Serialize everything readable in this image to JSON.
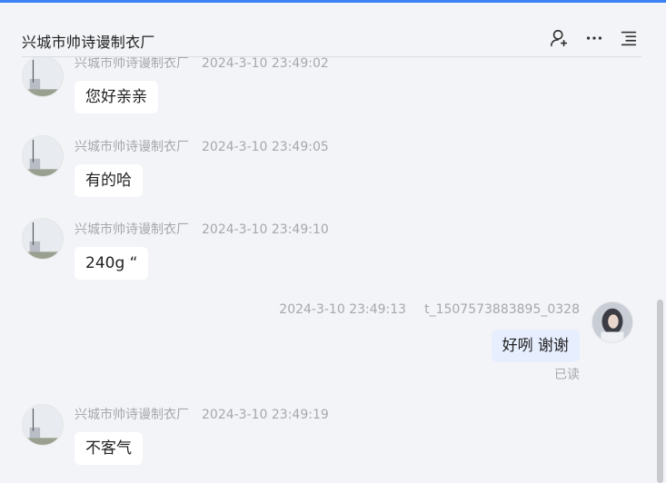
{
  "header": {
    "title": "兴城市帅诗谩制衣厂",
    "icons": [
      "add-user-icon",
      "more-icon",
      "menu-list-icon"
    ]
  },
  "colors": {
    "accent": "#3b82f6",
    "bubble_incoming": "#ffffff",
    "bubble_outgoing": "#e7efff",
    "background": "#f3f4f7"
  },
  "messages": [
    {
      "sender": "兴城市帅诗谩制衣厂",
      "time": "2024-3-10 23:49:02",
      "text": "您好亲亲"
    },
    {
      "sender": "兴城市帅诗谩制衣厂",
      "time": "2024-3-10 23:49:05",
      "text": "有的哈"
    },
    {
      "sender": "兴城市帅诗谩制衣厂",
      "time": "2024-3-10 23:49:10",
      "text": "240g  “"
    },
    {
      "sender": "t_1507573883895_0328",
      "time": "2024-3-10 23:49:13",
      "text": "好咧 谢谢",
      "status": "已读"
    },
    {
      "sender": "兴城市帅诗谩制衣厂",
      "time": "2024-3-10 23:49:19",
      "text": "不客气"
    }
  ]
}
